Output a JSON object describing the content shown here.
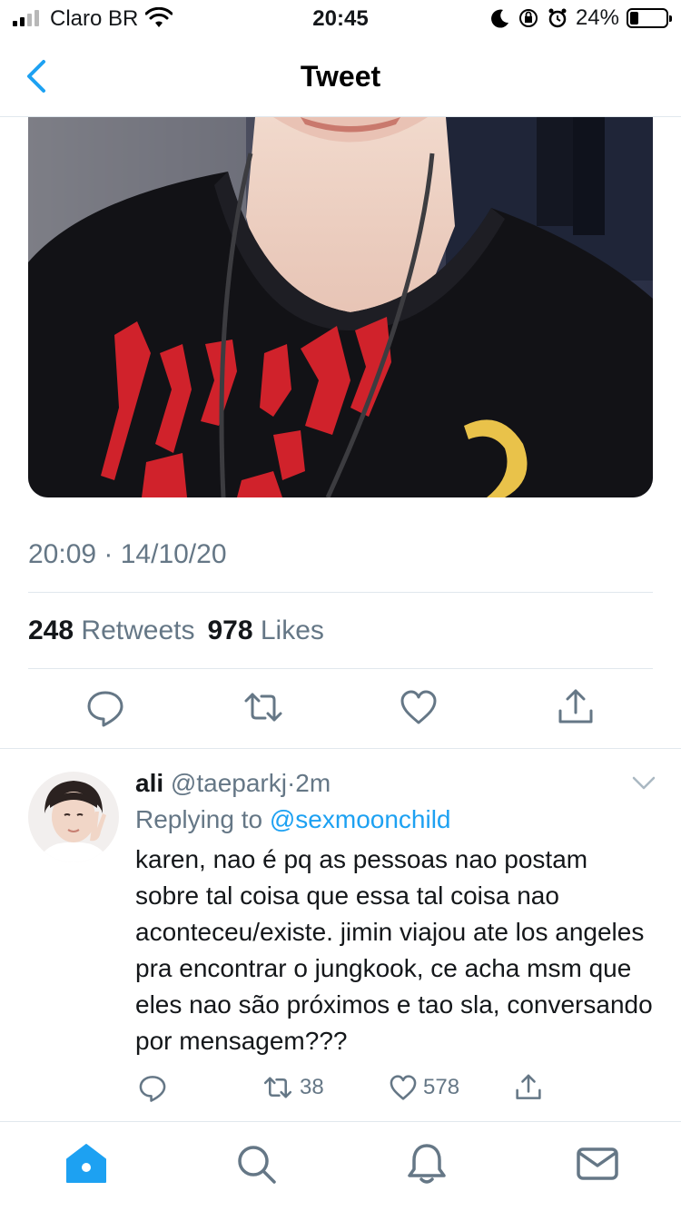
{
  "status": {
    "carrier": "Claro BR",
    "time": "20:45",
    "battery": "24%",
    "battery_level": 0.24
  },
  "nav": {
    "title": "Tweet",
    "back_icon": "chevron-left-icon"
  },
  "tweet": {
    "timestamp": "20:09 · 14/10/20",
    "retweets_count": "248",
    "retweets_label": "Retweets",
    "likes_count": "978",
    "likes_label": "Likes",
    "actions": [
      "reply-icon",
      "retweet-icon",
      "like-icon",
      "share-icon"
    ]
  },
  "reply": {
    "name": "ali",
    "handle": "@taeparkj",
    "dot": "·",
    "time": "2m",
    "replying_prefix": "Replying to",
    "replying_to": "@sexmoonchild",
    "text": "karen, nao é pq as pessoas nao postam sobre tal coisa que essa tal coisa nao aconteceu/existe. jimin viajou ate los angeles pra encontrar o jungkook, ce acha msm que eles nao são próximos e tao sla, conversando por mensagem???",
    "retweets": "38",
    "likes": "578"
  },
  "tabbar": {
    "tabs": [
      "home-icon",
      "search-icon",
      "notifications-icon",
      "messages-icon"
    ],
    "active": "home-icon"
  },
  "colors": {
    "accent": "#1da1f2",
    "secondary_text": "#657786",
    "divider": "#e1e8ed"
  }
}
